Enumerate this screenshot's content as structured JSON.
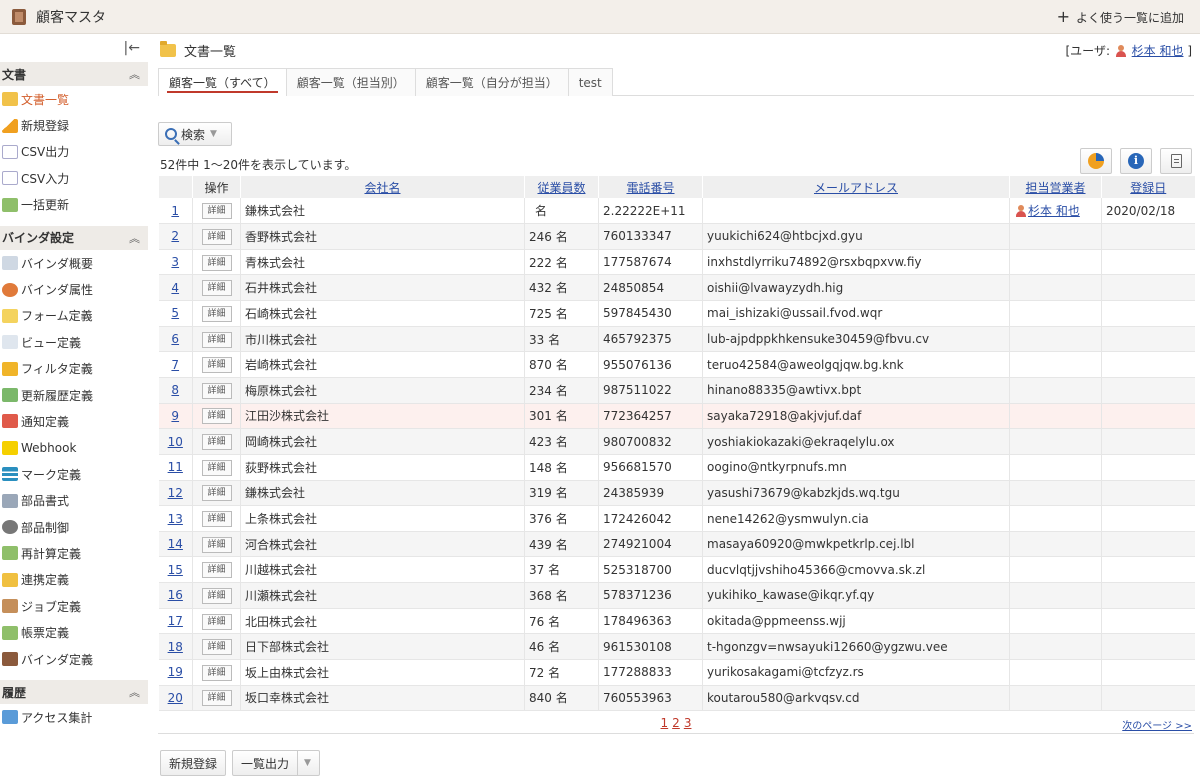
{
  "header": {
    "app_title": "顧客マスタ",
    "add_fav_label": "よく使う一覧に追加"
  },
  "sidebar": {
    "collapse_glyph": "|←",
    "sections": [
      {
        "title": "文書",
        "items": [
          "文書一覧",
          "新規登録",
          "CSV出力",
          "CSV入力",
          "一括更新"
        ]
      },
      {
        "title": "バインダ設定",
        "items": [
          "バインダ概要",
          "バインダ属性",
          "フォーム定義",
          "ビュー定義",
          "フィルタ定義",
          "更新履歴定義",
          "通知定義",
          "Webhook",
          "マーク定義",
          "部品書式",
          "部品制御",
          "再計算定義",
          "連携定義",
          "ジョブ定義",
          "帳票定義",
          "バインダ定義"
        ]
      },
      {
        "title": "履歴",
        "items": [
          "アクセス集計"
        ]
      }
    ]
  },
  "main": {
    "title": "文書一覧",
    "user_prefix": "[ユーザ:",
    "user_name": "杉本 和也",
    "user_suffix": "]",
    "tabs": [
      "顧客一覧（すべて）",
      "顧客一覧（担当別）",
      "顧客一覧（自分が担当）",
      "test"
    ],
    "search_label": "検索",
    "count_text": "52件中 1〜20件を表示しています。",
    "columns": [
      "操作",
      "会社名",
      "従業員数",
      "電話番号",
      "メールアドレス",
      "担当営業者",
      "登録日"
    ],
    "detail_label": "詳細",
    "rows": [
      {
        "no": "1",
        "company": "鎌株式会社",
        "employees": "名",
        "phone": "2.22222E+11",
        "email": "",
        "owner": "杉本 和也",
        "date": "2020/02/18"
      },
      {
        "no": "2",
        "company": "香野株式会社",
        "employees": "246 名",
        "phone": "760133347",
        "email": "yuukichi624@htbcjxd.gyu",
        "owner": "",
        "date": ""
      },
      {
        "no": "3",
        "company": "青株式会社",
        "employees": "222 名",
        "phone": "177587674",
        "email": "inxhstdlyrriku74892@rsxbqpxvw.fiy",
        "owner": "",
        "date": ""
      },
      {
        "no": "4",
        "company": "石井株式会社",
        "employees": "432 名",
        "phone": "24850854",
        "email": "oishii@lvawayzydh.hig",
        "owner": "",
        "date": ""
      },
      {
        "no": "5",
        "company": "石崎株式会社",
        "employees": "725 名",
        "phone": "597845430",
        "email": "mai_ishizaki@ussail.fvod.wqr",
        "owner": "",
        "date": ""
      },
      {
        "no": "6",
        "company": "市川株式会社",
        "employees": "33 名",
        "phone": "465792375",
        "email": "lub-ajpdppkhkensuke30459@fbvu.cv",
        "owner": "",
        "date": ""
      },
      {
        "no": "7",
        "company": "岩崎株式会社",
        "employees": "870 名",
        "phone": "955076136",
        "email": "teruo42584@aweolgqjqw.bg.knk",
        "owner": "",
        "date": ""
      },
      {
        "no": "8",
        "company": "梅原株式会社",
        "employees": "234 名",
        "phone": "987511022",
        "email": "hinano88335@awtivx.bpt",
        "owner": "",
        "date": ""
      },
      {
        "no": "9",
        "company": "江田沙株式会社",
        "employees": "301 名",
        "phone": "772364257",
        "email": "sayaka72918@akjvjuf.daf",
        "owner": "",
        "date": ""
      },
      {
        "no": "10",
        "company": "岡崎株式会社",
        "employees": "423 名",
        "phone": "980700832",
        "email": "yoshiakiokazaki@ekraqelylu.ox",
        "owner": "",
        "date": ""
      },
      {
        "no": "11",
        "company": "荻野株式会社",
        "employees": "148 名",
        "phone": "956681570",
        "email": "oogino@ntkyrpnufs.mn",
        "owner": "",
        "date": ""
      },
      {
        "no": "12",
        "company": "鎌株式会社",
        "employees": "319 名",
        "phone": "24385939",
        "email": "yasushi73679@kabzkjds.wq.tgu",
        "owner": "",
        "date": ""
      },
      {
        "no": "13",
        "company": "上条株式会社",
        "employees": "376 名",
        "phone": "172426042",
        "email": "nene14262@ysmwulyn.cia",
        "owner": "",
        "date": ""
      },
      {
        "no": "14",
        "company": "河合株式会社",
        "employees": "439 名",
        "phone": "274921004",
        "email": "masaya60920@mwkpetkrlp.cej.lbl",
        "owner": "",
        "date": ""
      },
      {
        "no": "15",
        "company": "川越株式会社",
        "employees": "37 名",
        "phone": "525318700",
        "email": "ducvlqtjjvshiho45366@cmovva.sk.zl",
        "owner": "",
        "date": ""
      },
      {
        "no": "16",
        "company": "川瀬株式会社",
        "employees": "368 名",
        "phone": "578371236",
        "email": "yukihiko_kawase@ikqr.yf.qy",
        "owner": "",
        "date": ""
      },
      {
        "no": "17",
        "company": "北田株式会社",
        "employees": "76 名",
        "phone": "178496363",
        "email": "okitada@ppmeenss.wjj",
        "owner": "",
        "date": ""
      },
      {
        "no": "18",
        "company": "日下部株式会社",
        "employees": "46 名",
        "phone": "961530108",
        "email": "t-hgonzgv=nwsayuki12660@ygzwu.vee",
        "owner": "",
        "date": ""
      },
      {
        "no": "19",
        "company": "坂上由株式会社",
        "employees": "72 名",
        "phone": "177288833",
        "email": "yurikosakagami@tcfzyz.rs",
        "owner": "",
        "date": ""
      },
      {
        "no": "20",
        "company": "坂口幸株式会社",
        "employees": "840 名",
        "phone": "760553963",
        "email": "koutarou580@arkvqsv.cd",
        "owner": "",
        "date": ""
      }
    ],
    "pages": [
      "1",
      "2",
      "3"
    ],
    "next_label": "次のページ >>",
    "new_button": "新規登録",
    "export_button": "一覧出力"
  },
  "colors": {
    "accent": "#d35e2b",
    "link": "#2a4ea6",
    "header_bg": "#f3efea",
    "highlight_row": "#fdf0ee"
  }
}
